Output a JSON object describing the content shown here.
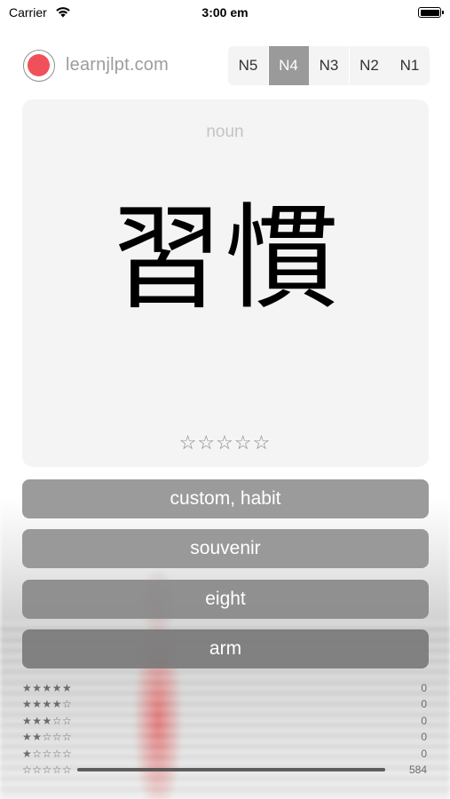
{
  "status_bar": {
    "carrier": "Carrier",
    "time": "3:00 em"
  },
  "header": {
    "site_name": "learnjlpt.com",
    "accent_color": "#f0505a",
    "levels": [
      {
        "label": "N5",
        "active": false
      },
      {
        "label": "N4",
        "active": true
      },
      {
        "label": "N3",
        "active": false
      },
      {
        "label": "N2",
        "active": false
      },
      {
        "label": "N1",
        "active": false
      }
    ]
  },
  "card": {
    "word_type": "noun",
    "kanji": "習慣",
    "rating": "☆☆☆☆☆"
  },
  "answers": [
    {
      "label": "custom, habit"
    },
    {
      "label": "souvenir"
    },
    {
      "label": "eight"
    },
    {
      "label": "arm"
    }
  ],
  "stats": [
    {
      "stars": "★★★★★",
      "count": "0"
    },
    {
      "stars": "★★★★☆",
      "count": "0"
    },
    {
      "stars": "★★★☆☆",
      "count": "0"
    },
    {
      "stars": "★★☆☆☆",
      "count": "0"
    },
    {
      "stars": "★☆☆☆☆",
      "count": "0"
    },
    {
      "stars": "☆☆☆☆☆",
      "count": "584"
    }
  ],
  "progress_fraction": 1.0
}
